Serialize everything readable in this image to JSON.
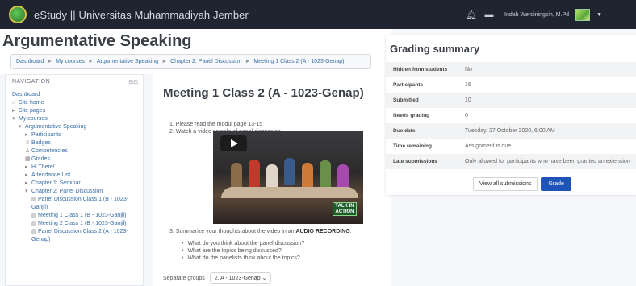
{
  "navbar": {
    "brand": "eStudy || Universitas Muhammadiyah Jember",
    "user_name": "Indah Werdiningsih, M.Pd"
  },
  "header": {
    "title": "Argumentative Speaking",
    "breadcrumb": [
      "Dashboard",
      "My courses",
      "Argumentative Speaking",
      "Chapter 2: Panel Discussion",
      "Meeting 1 Class 2 (A - 1023-Genap)"
    ]
  },
  "navigation": {
    "heading": "NAVIGATION",
    "items": [
      {
        "label": "Dashboard",
        "icon": "",
        "level": 1
      },
      {
        "label": "Site home",
        "icon": "home-icon",
        "level": 1
      },
      {
        "label": "Site pages",
        "icon": "arrow-right-icon",
        "level": 1
      },
      {
        "label": "My courses",
        "icon": "arrow-down-icon",
        "level": 1
      },
      {
        "label": "Argumentative Speaking",
        "icon": "arrow-down-icon",
        "level": 2
      },
      {
        "label": "Participants",
        "icon": "arrow-right-icon",
        "level": 3
      },
      {
        "label": "Badges",
        "icon": "badge-icon",
        "level": 3
      },
      {
        "label": "Competencies",
        "icon": "competency-icon",
        "level": 3
      },
      {
        "label": "Grades",
        "icon": "grades-icon",
        "level": 3
      },
      {
        "label": "Hi There!",
        "icon": "arrow-right-icon",
        "level": 3
      },
      {
        "label": "Attendance List",
        "icon": "arrow-right-icon",
        "level": 3
      },
      {
        "label": "Chapter 1: Seminar",
        "icon": "arrow-right-icon",
        "level": 3
      },
      {
        "label": "Chapter 2: Panel Discussion",
        "icon": "arrow-down-icon",
        "level": 3
      },
      {
        "label": "Panel Discussion Class 1 (B - 1023-Ganjil)",
        "icon": "assignment-icon",
        "level": 4
      },
      {
        "label": "Meeting 1 Class 1 (B - 1023-Ganjil)",
        "icon": "assignment-icon",
        "level": 4
      },
      {
        "label": "Meeting 2 Class 1 (B - 1023-Ganjil)",
        "icon": "assignment-icon",
        "level": 4
      },
      {
        "label": "Panel Discussion Class 2 (A - 1023-Genap)",
        "icon": "assignment-icon",
        "level": 4
      }
    ]
  },
  "main": {
    "title": "Meeting 1 Class 2 (A - 1023-Genap)",
    "instructions": [
      "1. Please read the modul page 13-15",
      "2. Watch a video sample of panel discussion"
    ],
    "step3_prefix": "3. Summarize your thoughts about the video in an ",
    "step3_bold": "AUDIO RECORDING",
    "step3_suffix": ":",
    "questions": [
      "What do you think about the panel discussion?",
      "What are the topics being discussed?",
      "What do the panelists think about the topics?"
    ],
    "video_badge": "TALK IN ACTION",
    "groups_label": "Separate groups",
    "groups_value": "2. A - 1023-Genap"
  },
  "grading": {
    "title": "Grading summary",
    "rows": [
      {
        "label": "Hidden from students",
        "value": "No"
      },
      {
        "label": "Participants",
        "value": "16"
      },
      {
        "label": "Submitted",
        "value": "10"
      },
      {
        "label": "Needs grading",
        "value": "0"
      },
      {
        "label": "Due date",
        "value": "Tuesday, 27 October 2020, 6:00 AM"
      },
      {
        "label": "Time remaining",
        "value": "Assignment is due"
      },
      {
        "label": "Late submissions",
        "value": "Only allowed for participants who have been granted an extension"
      }
    ],
    "view_all_label": "View all submissions",
    "grade_label": "Grade"
  }
}
